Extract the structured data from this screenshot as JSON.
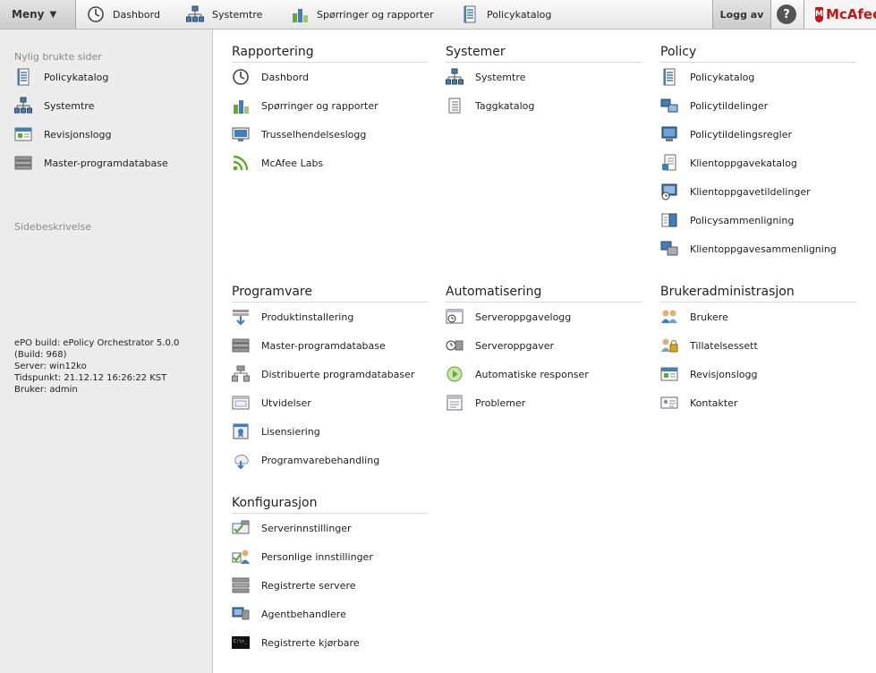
{
  "topbar": {
    "menu_label": "Meny",
    "menu_caret": "▼",
    "nav": [
      {
        "label": "Dashbord",
        "icon": "dashboard-icon"
      },
      {
        "label": "Systemtre",
        "icon": "system-tree-icon"
      },
      {
        "label": "Spørringer og rapporter",
        "icon": "queries-reports-icon"
      },
      {
        "label": "Policykatalog",
        "icon": "policy-catalog-icon"
      }
    ],
    "logout_label": "Logg av",
    "help_label": "?",
    "brand_text": "McAfee",
    "brand_shield": "M"
  },
  "sidebar": {
    "recent_title": "Nylig brukte sider",
    "recent_items": [
      {
        "label": "Policykatalog",
        "icon": "policy-catalog-icon"
      },
      {
        "label": "Systemtre",
        "icon": "system-tree-icon"
      },
      {
        "label": "Revisjonslogg",
        "icon": "audit-log-icon"
      },
      {
        "label": "Master-programdatabase",
        "icon": "repository-icon"
      }
    ],
    "description_label": "Sidebeskrivelse",
    "build_info": [
      "ePO build: ePolicy Orchestrator 5.0.0",
      "(Build: 968)",
      "Server: win12ko",
      "Tidspunkt: 21.12.12 16:26:22 KST",
      "Bruker: admin"
    ]
  },
  "sections": {
    "rapportering": {
      "title": "Rapportering",
      "items": [
        {
          "label": "Dashbord",
          "icon": "dashboard-icon"
        },
        {
          "label": "Spørringer og rapporter",
          "icon": "queries-reports-icon"
        },
        {
          "label": "Trusselhendelseslogg",
          "icon": "threat-log-icon"
        },
        {
          "label": "McAfee Labs",
          "icon": "rss-icon"
        }
      ]
    },
    "systemer": {
      "title": "Systemer",
      "items": [
        {
          "label": "Systemtre",
          "icon": "system-tree-icon"
        },
        {
          "label": "Taggkatalog",
          "icon": "tag-catalog-icon"
        }
      ]
    },
    "policy": {
      "title": "Policy",
      "items": [
        {
          "label": "Policykatalog",
          "icon": "policy-catalog-icon"
        },
        {
          "label": "Policytildelinger",
          "icon": "policy-assignment-icon"
        },
        {
          "label": "Policytildelingsregler",
          "icon": "policy-rules-icon"
        },
        {
          "label": "Klientoppgavekatalog",
          "icon": "client-task-catalog-icon"
        },
        {
          "label": "Klientoppgavetildelinger",
          "icon": "client-task-assignment-icon"
        },
        {
          "label": "Policysammenligning",
          "icon": "policy-compare-icon"
        },
        {
          "label": "Klientoppgavesammenligning",
          "icon": "client-task-compare-icon"
        }
      ]
    },
    "programvare": {
      "title": "Programvare",
      "items": [
        {
          "label": "Produktinstallering",
          "icon": "product-deploy-icon"
        },
        {
          "label": "Master-programdatabase",
          "icon": "repository-icon"
        },
        {
          "label": "Distribuerte programdatabaser",
          "icon": "distributed-repo-icon"
        },
        {
          "label": "Utvidelser",
          "icon": "extensions-icon"
        },
        {
          "label": "Lisensiering",
          "icon": "licensing-icon"
        },
        {
          "label": "Programvarebehandling",
          "icon": "software-manager-icon"
        }
      ]
    },
    "automatisering": {
      "title": "Automatisering",
      "items": [
        {
          "label": "Serveroppgavelogg",
          "icon": "server-task-log-icon"
        },
        {
          "label": "Serveroppgaver",
          "icon": "server-tasks-icon"
        },
        {
          "label": "Automatiske responser",
          "icon": "automatic-responses-icon"
        },
        {
          "label": "Problemer",
          "icon": "issues-icon"
        }
      ]
    },
    "brukeradministrasjon": {
      "title": "Brukeradministrasjon",
      "items": [
        {
          "label": "Brukere",
          "icon": "users-icon"
        },
        {
          "label": "Tillatelsessett",
          "icon": "permission-sets-icon"
        },
        {
          "label": "Revisjonslogg",
          "icon": "audit-log-icon"
        },
        {
          "label": "Kontakter",
          "icon": "contacts-icon"
        }
      ]
    },
    "konfigurasjon": {
      "title": "Konfigurasjon",
      "items": [
        {
          "label": "Serverinnstillinger",
          "icon": "server-settings-icon"
        },
        {
          "label": "Personlige innstillinger",
          "icon": "personal-settings-icon"
        },
        {
          "label": "Registrerte servere",
          "icon": "registered-servers-icon"
        },
        {
          "label": "Agentbehandlere",
          "icon": "agent-handlers-icon"
        },
        {
          "label": "Registrerte kjørbare",
          "icon": "registered-executables-icon"
        }
      ]
    }
  },
  "colors": {
    "brand_red": "#c01818",
    "icon_blue": "#3f7fc0",
    "icon_green": "#5cae2a",
    "sidebar_bg": "#ececec"
  }
}
